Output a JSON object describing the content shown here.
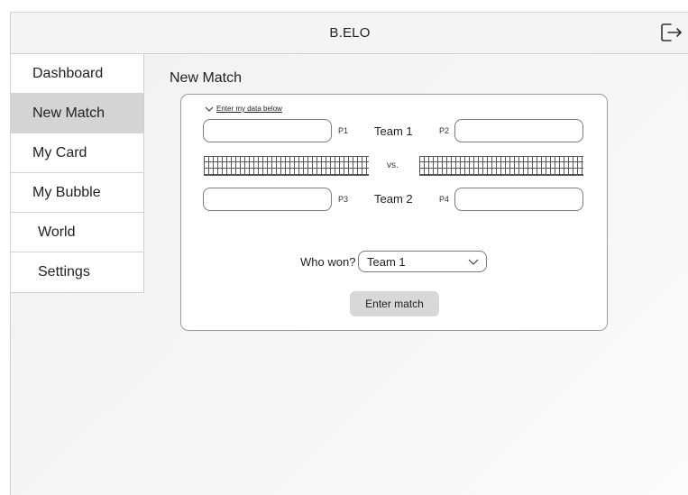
{
  "app": {
    "title": "B.ELO"
  },
  "header": {
    "logout_icon": "logout-icon"
  },
  "sidebar": {
    "items": [
      {
        "label": "Dashboard",
        "active": false
      },
      {
        "label": "New Match",
        "active": true
      },
      {
        "label": "My Card",
        "active": false
      },
      {
        "label": "My Bubble",
        "active": false
      },
      {
        "label": "World",
        "active": false
      },
      {
        "label": "Settings",
        "active": false
      }
    ]
  },
  "main": {
    "title": "New Match",
    "form": {
      "disclosure_label": "Enter my data below",
      "players": {
        "p1": {
          "label": "P1",
          "value": "",
          "placeholder": ""
        },
        "p2": {
          "label": "P2",
          "value": "",
          "placeholder": ""
        },
        "p3": {
          "label": "P3",
          "value": "",
          "placeholder": ""
        },
        "p4": {
          "label": "P4",
          "value": "",
          "placeholder": ""
        }
      },
      "team1_label": "Team 1",
      "team2_label": "Team 2",
      "vs_label": "vs.",
      "winner_question": "Who won?",
      "winner_selected": "Team 1",
      "submit_label": "Enter match"
    }
  },
  "colors": {
    "active_nav": "#d4d4d4",
    "button": "#d8d8d8",
    "border": "#9a9a9a"
  }
}
